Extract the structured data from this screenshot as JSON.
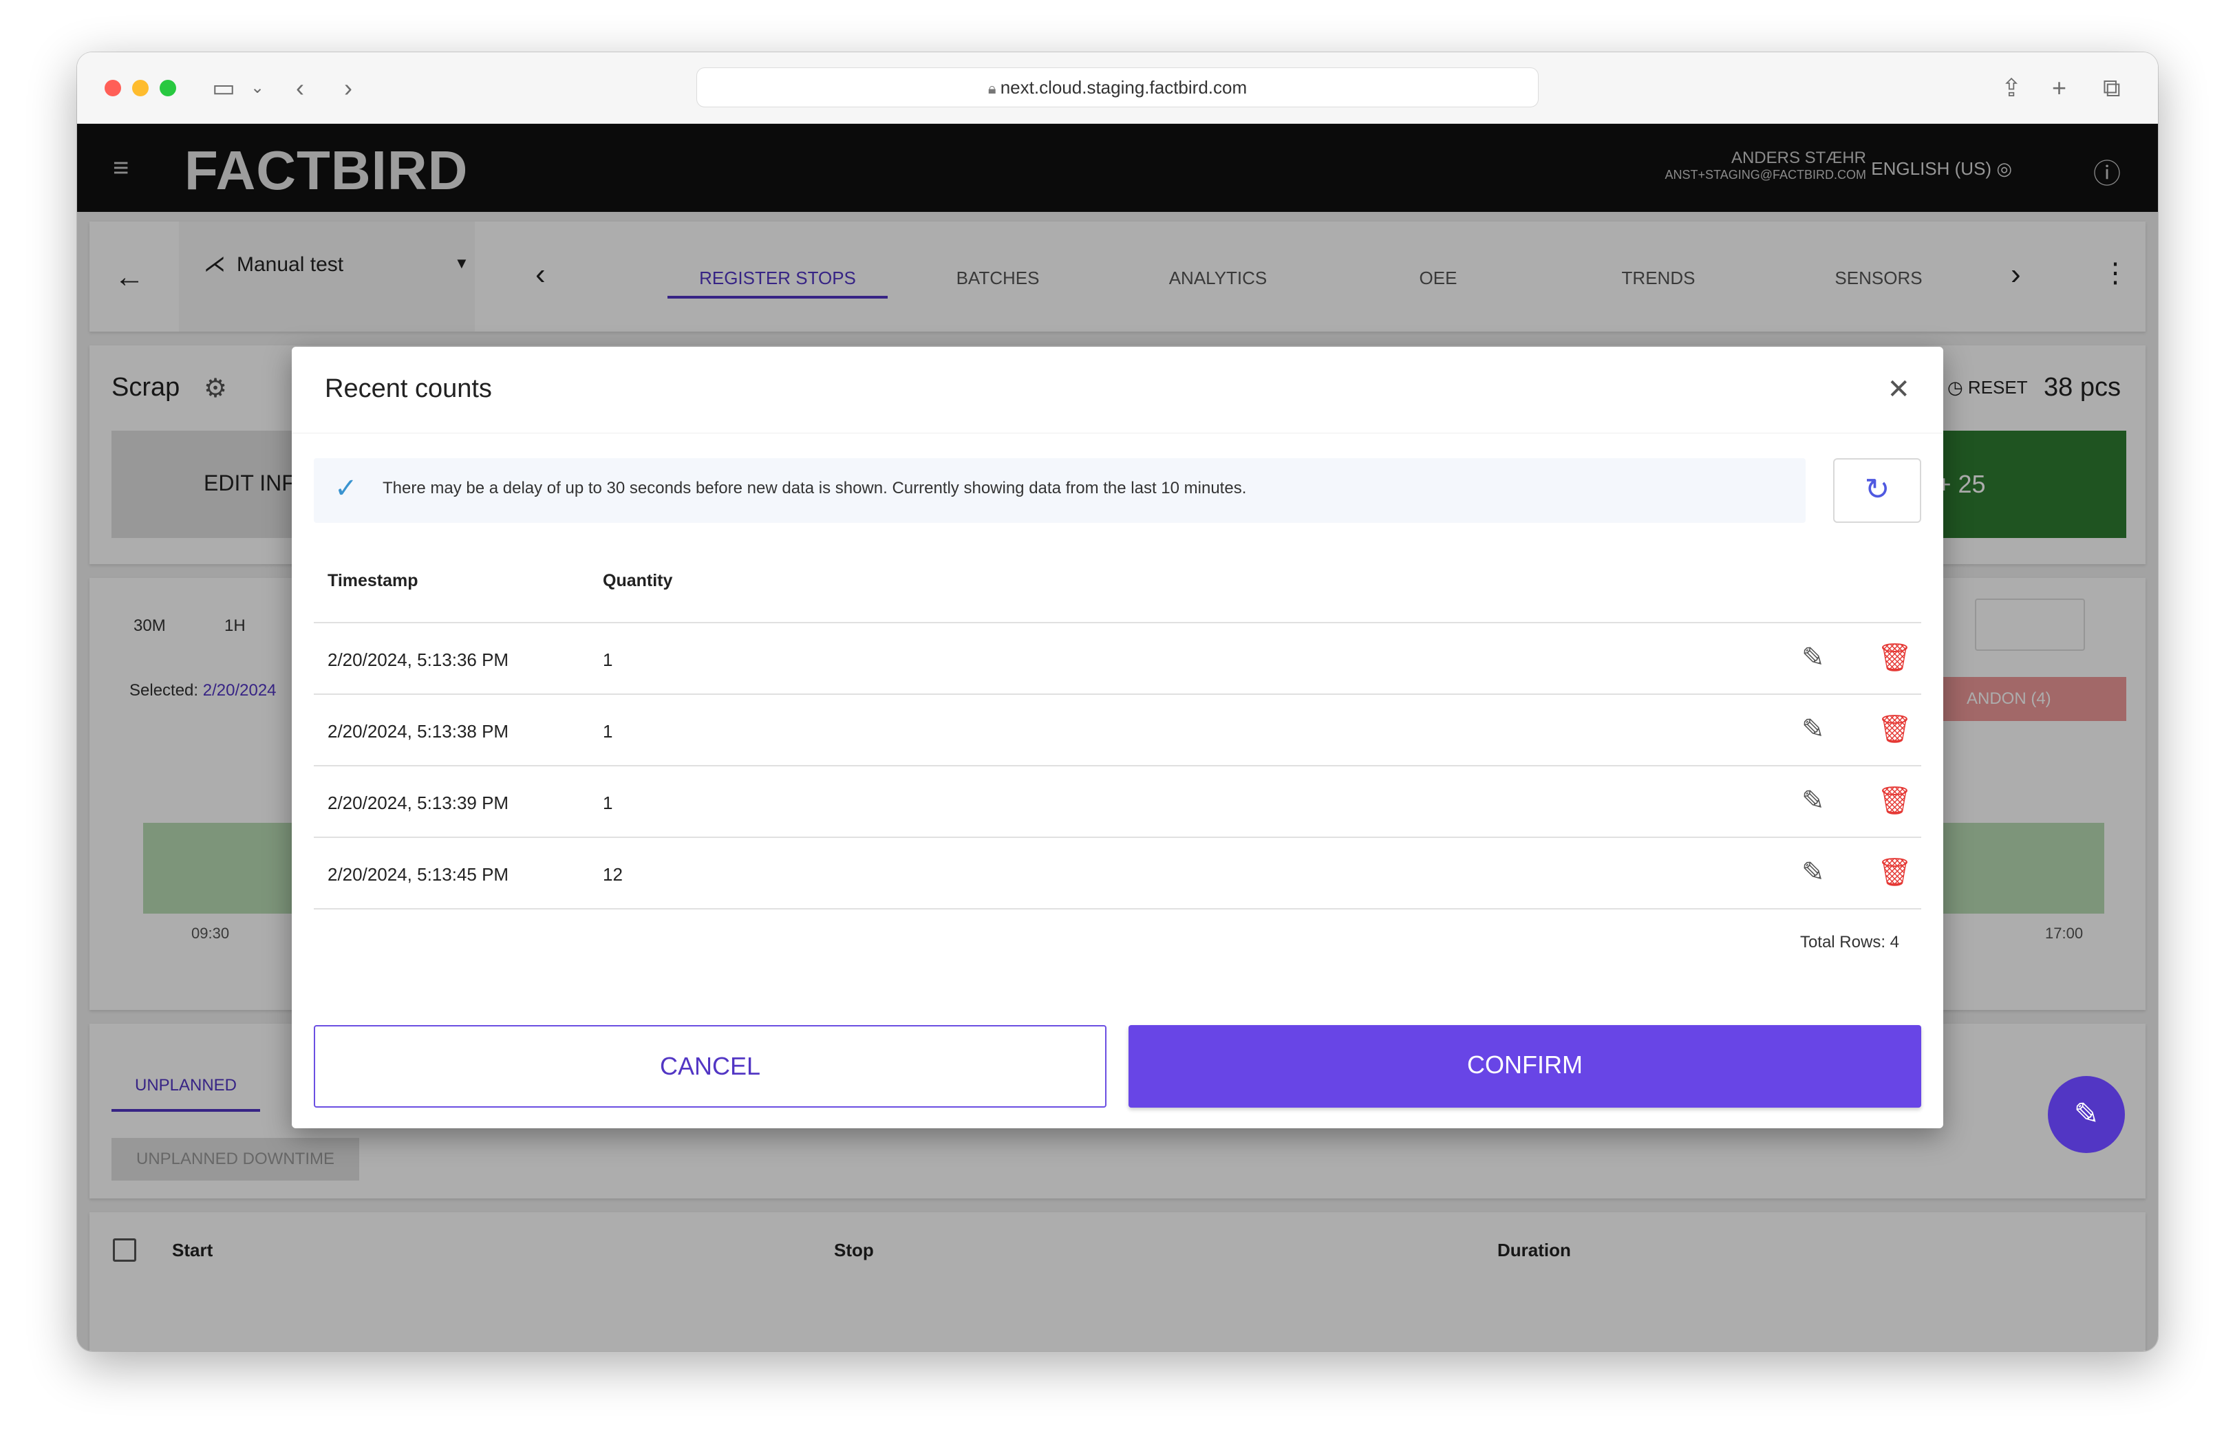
{
  "browser": {
    "url": "next.cloud.staging.factbird.com"
  },
  "app": {
    "logo": "FACTBIRD",
    "user_name": "ANDERS STÆHR",
    "user_email": "ANST+STAGING@FACTBIRD.COM",
    "language": "ENGLISH (US)",
    "line_name": "Manual test",
    "tabs": [
      {
        "label": "REGISTER STOPS",
        "active": true
      },
      {
        "label": "BATCHES",
        "active": false
      },
      {
        "label": "ANALYTICS",
        "active": false
      },
      {
        "label": "OEE",
        "active": false
      },
      {
        "label": "TRENDS",
        "active": false
      },
      {
        "label": "SENSORS",
        "active": false
      }
    ]
  },
  "background": {
    "scrap_title": "Scrap",
    "reset_label": "RESET",
    "count": "38 pcs",
    "edit_button": "EDIT INF",
    "plus_button": "+ 25",
    "range_30m": "30M",
    "range_1h": "1H",
    "selected_label": "Selected:",
    "selected_value": "2/20/2024",
    "andon_label": "ANDON (4)",
    "axis_start": "09:30",
    "axis_end": "17:00",
    "unplanned_tab": "UNPLANNED",
    "unplanned_downtime": "UNPLANNED DOWNTIME",
    "col_start": "Start",
    "col_stop": "Stop",
    "col_duration": "Duration"
  },
  "modal": {
    "title": "Recent counts",
    "info": "There may be a delay of up to 30 seconds before new data is shown. Currently showing data from the last 10 minutes.",
    "col_timestamp": "Timestamp",
    "col_quantity": "Quantity",
    "rows": [
      {
        "timestamp": "2/20/2024, 5:13:36 PM",
        "quantity": "1"
      },
      {
        "timestamp": "2/20/2024, 5:13:38 PM",
        "quantity": "1"
      },
      {
        "timestamp": "2/20/2024, 5:13:39 PM",
        "quantity": "1"
      },
      {
        "timestamp": "2/20/2024, 5:13:45 PM",
        "quantity": "12"
      }
    ],
    "total_rows": "Total Rows: 4",
    "cancel": "CANCEL",
    "confirm": "CONFIRM"
  },
  "colors": {
    "accent": "#6845e6",
    "delete": "#e53935",
    "green": "#2e7d32"
  }
}
